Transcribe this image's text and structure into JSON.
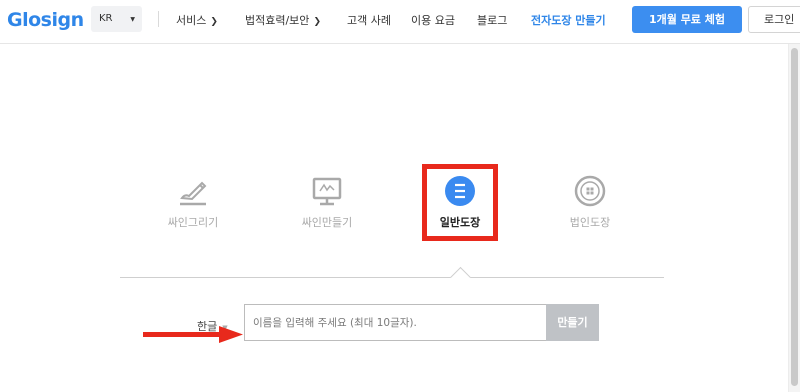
{
  "header": {
    "logo": "Glosign",
    "language": "KR",
    "nav": [
      {
        "label": "서비스",
        "dropdown": true
      },
      {
        "label": "법적효력/보안",
        "dropdown": true
      },
      {
        "label": "고객 사례",
        "dropdown": false
      },
      {
        "label": "이용 요금",
        "dropdown": false
      },
      {
        "label": "블로그",
        "dropdown": false
      },
      {
        "label": "전자도장 만들기",
        "dropdown": false,
        "highlight": true
      }
    ],
    "trial_button": "1개월 무료 체험",
    "login_button": "로그인"
  },
  "tabs": [
    {
      "label": "싸인그리기",
      "icon": "pen-draw-icon",
      "active": false
    },
    {
      "label": "싸인만들기",
      "icon": "monitor-sign-icon",
      "active": false
    },
    {
      "label": "일반도장",
      "icon": "stamp-icon",
      "active": true
    },
    {
      "label": "법인도장",
      "icon": "corporate-seal-icon",
      "active": false
    }
  ],
  "form": {
    "language_select": "한글",
    "name_placeholder": "이름을 입력해 주세요 (최대 10글자).",
    "make_button": "만들기"
  },
  "colors": {
    "brand": "#2f86e8",
    "primary_button": "#3c8ef0",
    "annotation_red": "#e8291c",
    "disabled_button": "#bfc2c6"
  }
}
